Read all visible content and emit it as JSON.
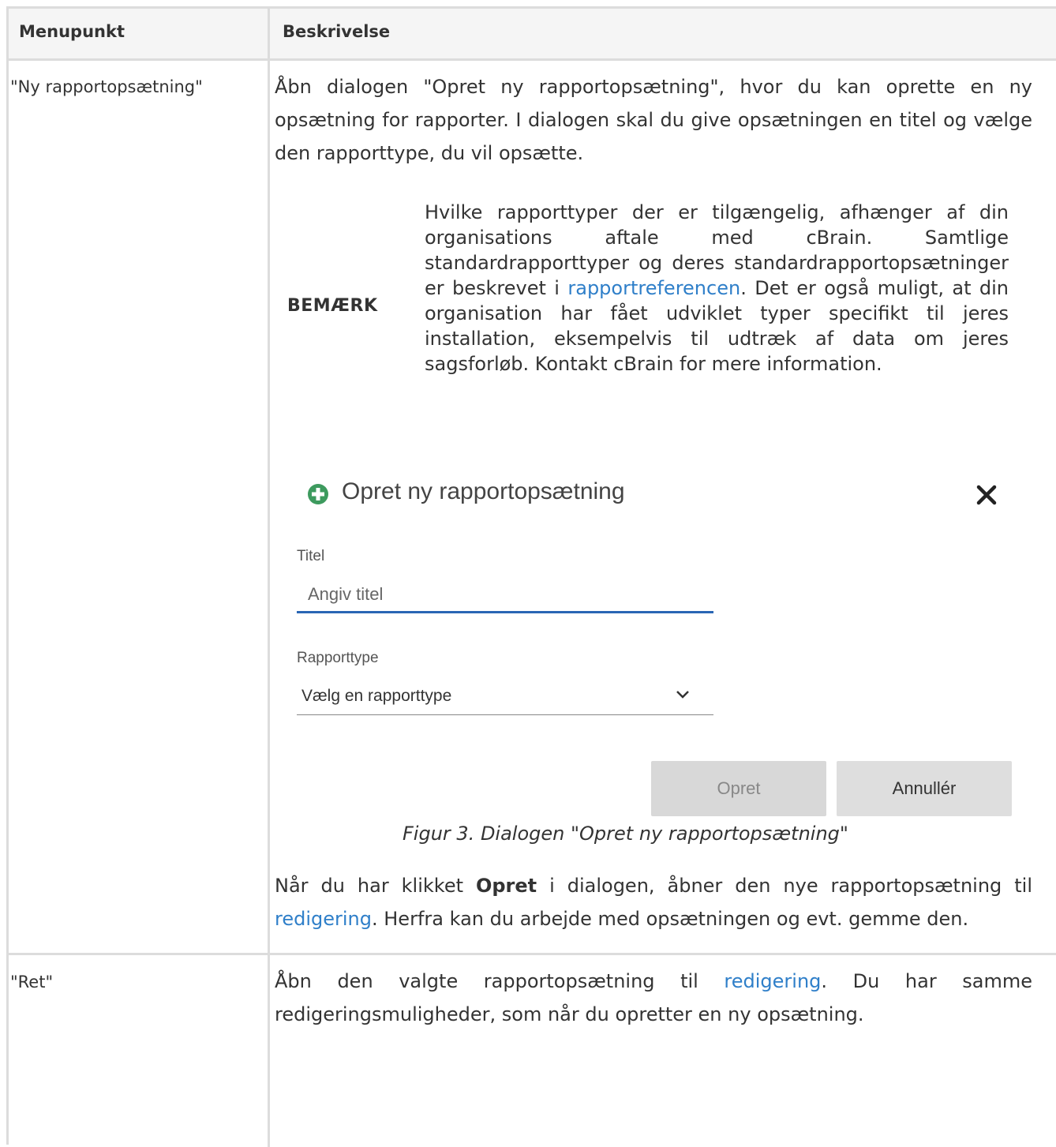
{
  "header": {
    "col1": "Menupunkt",
    "col2": "Beskrivelse"
  },
  "row1": {
    "label": "\"Ny rapportopsætning\"",
    "para1": "Åbn dialogen \"Opret ny rapportopsætning\", hvor du kan oprette en ny opsætning for rapporter. I dialogen skal du give opsætningen en titel og vælge den rapporttype, du vil opsætte.",
    "note": {
      "label": "BEMÆRK",
      "text_before": "Hvilke rapporttyper der er tilgængelig, afhænger af din organisations aftale med cBrain. Samtlige standardrapporttyper og deres standardrapportopsætninger er beskrevet i ",
      "link": "rapportreferencen",
      "text_after": ". Det er også muligt, at din organisation har fået udviklet typer specifikt til jeres installation, eksempelvis til udtræk af data om jeres sagsforløb. Kontakt cBrain for mere information."
    },
    "dialog": {
      "title": "Opret ny rapportopsætning",
      "title_field_label": "Titel",
      "title_field_placeholder": "Angiv titel",
      "type_field_label": "Rapporttype",
      "type_field_value": "Vælg en rapporttype",
      "create_button": "Opret",
      "cancel_button": "Annullér",
      "accent_color": "#2a66b4",
      "icon_color": "#3d9a5e"
    },
    "caption": "Figur 3. Dialogen \"Opret ny rapportopsætning\"",
    "para2": {
      "t1": "Når du har klikket ",
      "bold": "Opret",
      "t2": " i dialogen, åbner den nye rapportopsætning til ",
      "link": "redigering",
      "t3": ". Herfra kan du arbejde med opsætningen og evt. gemme den."
    }
  },
  "row2": {
    "label": "\"Ret\"",
    "t1": "Åbn den valgte rapportopsætning til ",
    "link": "redigering",
    "t2": ". Du har samme redigeringsmuligheder, som når du opretter en ny opsætning."
  },
  "link_color": "#2f7fc9"
}
